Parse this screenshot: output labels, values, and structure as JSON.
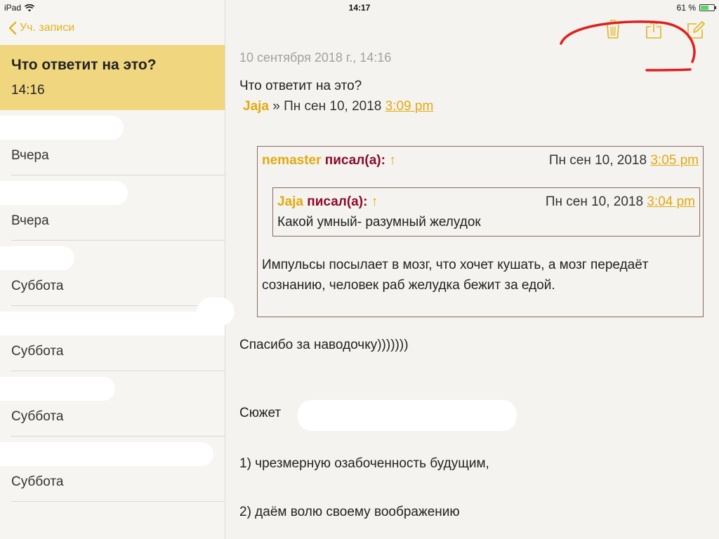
{
  "status": {
    "device": "iPad",
    "time": "14:17",
    "battery": "61 %",
    "battery_level": 0.61
  },
  "sidebar": {
    "back_label": "Уч. записи",
    "selected": {
      "title": "Что ответит на это?",
      "time": "14:16"
    },
    "items": [
      {
        "date": "Вчера"
      },
      {
        "date": "Вчера"
      },
      {
        "date": "Суббота"
      },
      {
        "date": "Суббота"
      },
      {
        "date": "Суббота"
      },
      {
        "date": "Суббота"
      }
    ]
  },
  "note": {
    "date": "10 сентября 2018 г., 14:16",
    "title": "Что ответит на это?",
    "post": {
      "author": "Jaja",
      "sep": " » Пн сен 10, 2018 ",
      "time": "3:09 pm"
    },
    "quote": {
      "author": "nemaster",
      "wrote": " писал(а): ",
      "arrow": "↑",
      "date": "Пн сен 10, 2018 ",
      "time": "3:05 pm",
      "text": "Импульсы посылает в мозг, что хочет кушать, а мозг передаёт сознанию, человек раб желудка бежит за едой.",
      "inner": {
        "author": "Jaja",
        "wrote": " писал(а): ",
        "arrow": "↑",
        "date": "Пн сен 10, 2018 ",
        "time": "3:04 pm",
        "text": "Какой умный- разумный желудок"
      }
    },
    "p1": "Спасибо за наводочку)))))))",
    "p2": "Сюжет",
    "p3": "1) чрезмерную озабоченность будущим,",
    "p4": "2) даём волю своему воображению"
  },
  "colors": {
    "accent": "#e3a90f",
    "maroon": "#8c0a2a",
    "selected_bg": "#f0d77f",
    "annotation": "#e02020"
  }
}
